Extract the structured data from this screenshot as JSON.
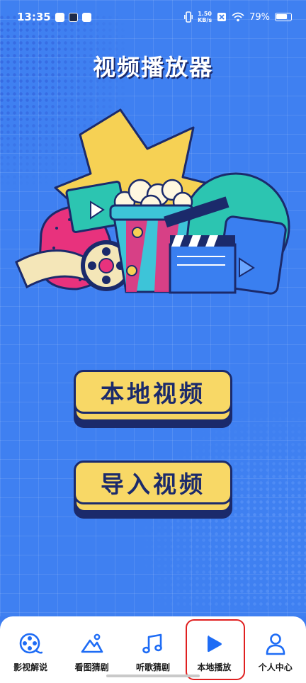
{
  "status_bar": {
    "time": "13:35",
    "net_speed_value": "1.50",
    "net_speed_unit": "KB/s",
    "battery": "79%"
  },
  "app_title": "视频播放器",
  "buttons": {
    "local_video": "本地视频",
    "import_video": "导入视频"
  },
  "tabbar": {
    "items": [
      {
        "label": "影视解说",
        "icon": "film-reel-icon"
      },
      {
        "label": "看图猜剧",
        "icon": "image-mountain-icon"
      },
      {
        "label": "听歌猜剧",
        "icon": "music-note-icon"
      },
      {
        "label": "本地播放",
        "icon": "play-icon",
        "selected": true
      },
      {
        "label": "个人中心",
        "icon": "person-icon"
      }
    ]
  },
  "colors": {
    "background": "#3f80f1",
    "button_fill": "#f8d866",
    "outline": "#1b2a6b",
    "accent": "#1e6cf5",
    "highlight": "#e02020"
  }
}
